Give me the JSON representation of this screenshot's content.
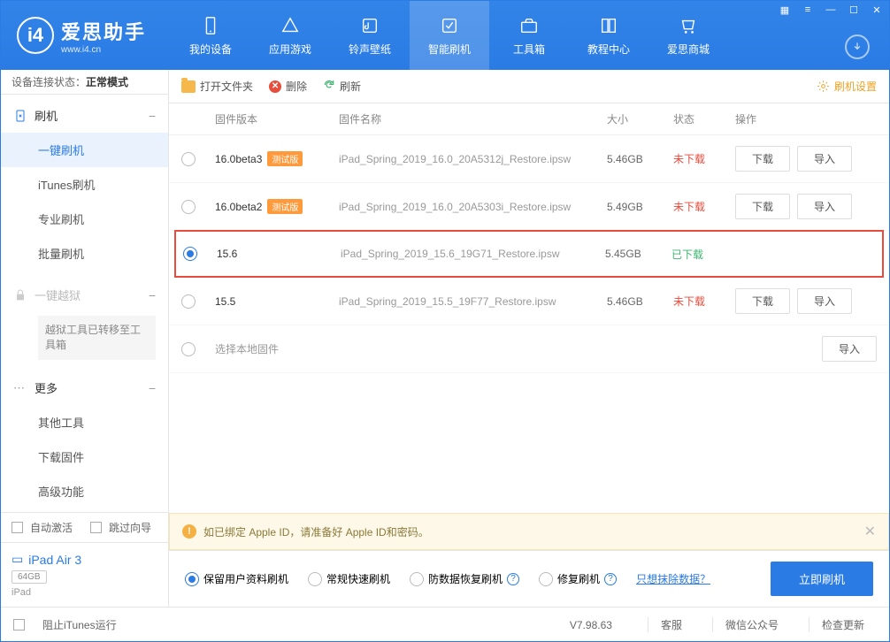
{
  "app": {
    "title": "爱思助手",
    "subtitle": "www.i4.cn"
  },
  "nav": [
    {
      "label": "我的设备"
    },
    {
      "label": "应用游戏"
    },
    {
      "label": "铃声壁纸"
    },
    {
      "label": "智能刷机"
    },
    {
      "label": "工具箱"
    },
    {
      "label": "教程中心"
    },
    {
      "label": "爱思商城"
    }
  ],
  "status": {
    "label": "设备连接状态：",
    "value": "正常模式"
  },
  "sidebar": {
    "flash": {
      "header": "刷机",
      "items": [
        "一键刷机",
        "iTunes刷机",
        "专业刷机",
        "批量刷机"
      ]
    },
    "jailbreak": {
      "header": "一键越狱",
      "note": "越狱工具已转移至工具箱"
    },
    "more": {
      "header": "更多",
      "items": [
        "其他工具",
        "下载固件",
        "高级功能"
      ]
    },
    "auto_activate": "自动激活",
    "skip_guide": "跳过向导"
  },
  "device": {
    "name": "iPad Air 3",
    "capacity": "64GB",
    "type": "iPad"
  },
  "toolbar": {
    "open": "打开文件夹",
    "delete": "删除",
    "refresh": "刷新",
    "settings": "刷机设置"
  },
  "columns": {
    "version": "固件版本",
    "name": "固件名称",
    "size": "大小",
    "status": "状态",
    "ops": "操作"
  },
  "status_labels": {
    "not_downloaded": "未下载",
    "downloaded": "已下载"
  },
  "btn": {
    "download": "下载",
    "import": "导入"
  },
  "beta_tag": "测试版",
  "firmware": [
    {
      "version": "16.0beta3",
      "beta": true,
      "name": "iPad_Spring_2019_16.0_20A5312j_Restore.ipsw",
      "size": "5.46GB",
      "status": "nd",
      "selected": false,
      "ops": true
    },
    {
      "version": "16.0beta2",
      "beta": true,
      "name": "iPad_Spring_2019_16.0_20A5303i_Restore.ipsw",
      "size": "5.49GB",
      "status": "nd",
      "selected": false,
      "ops": true
    },
    {
      "version": "15.6",
      "beta": false,
      "name": "iPad_Spring_2019_15.6_19G71_Restore.ipsw",
      "size": "5.45GB",
      "status": "dl",
      "selected": true,
      "ops": false
    },
    {
      "version": "15.5",
      "beta": false,
      "name": "iPad_Spring_2019_15.5_19F77_Restore.ipsw",
      "size": "5.46GB",
      "status": "nd",
      "selected": false,
      "ops": true
    }
  ],
  "local_fw": "选择本地固件",
  "warning": "如已绑定 Apple ID，请准备好 Apple ID和密码。",
  "options": {
    "keep": "保留用户资料刷机",
    "normal": "常规快速刷机",
    "anti": "防数据恢复刷机",
    "repair": "修复刷机",
    "erase_link": "只想抹除数据？"
  },
  "flash_now": "立即刷机",
  "footer": {
    "block_itunes": "阻止iTunes运行",
    "version": "V7.98.63",
    "kefu": "客服",
    "wechat": "微信公众号",
    "update": "检查更新"
  }
}
